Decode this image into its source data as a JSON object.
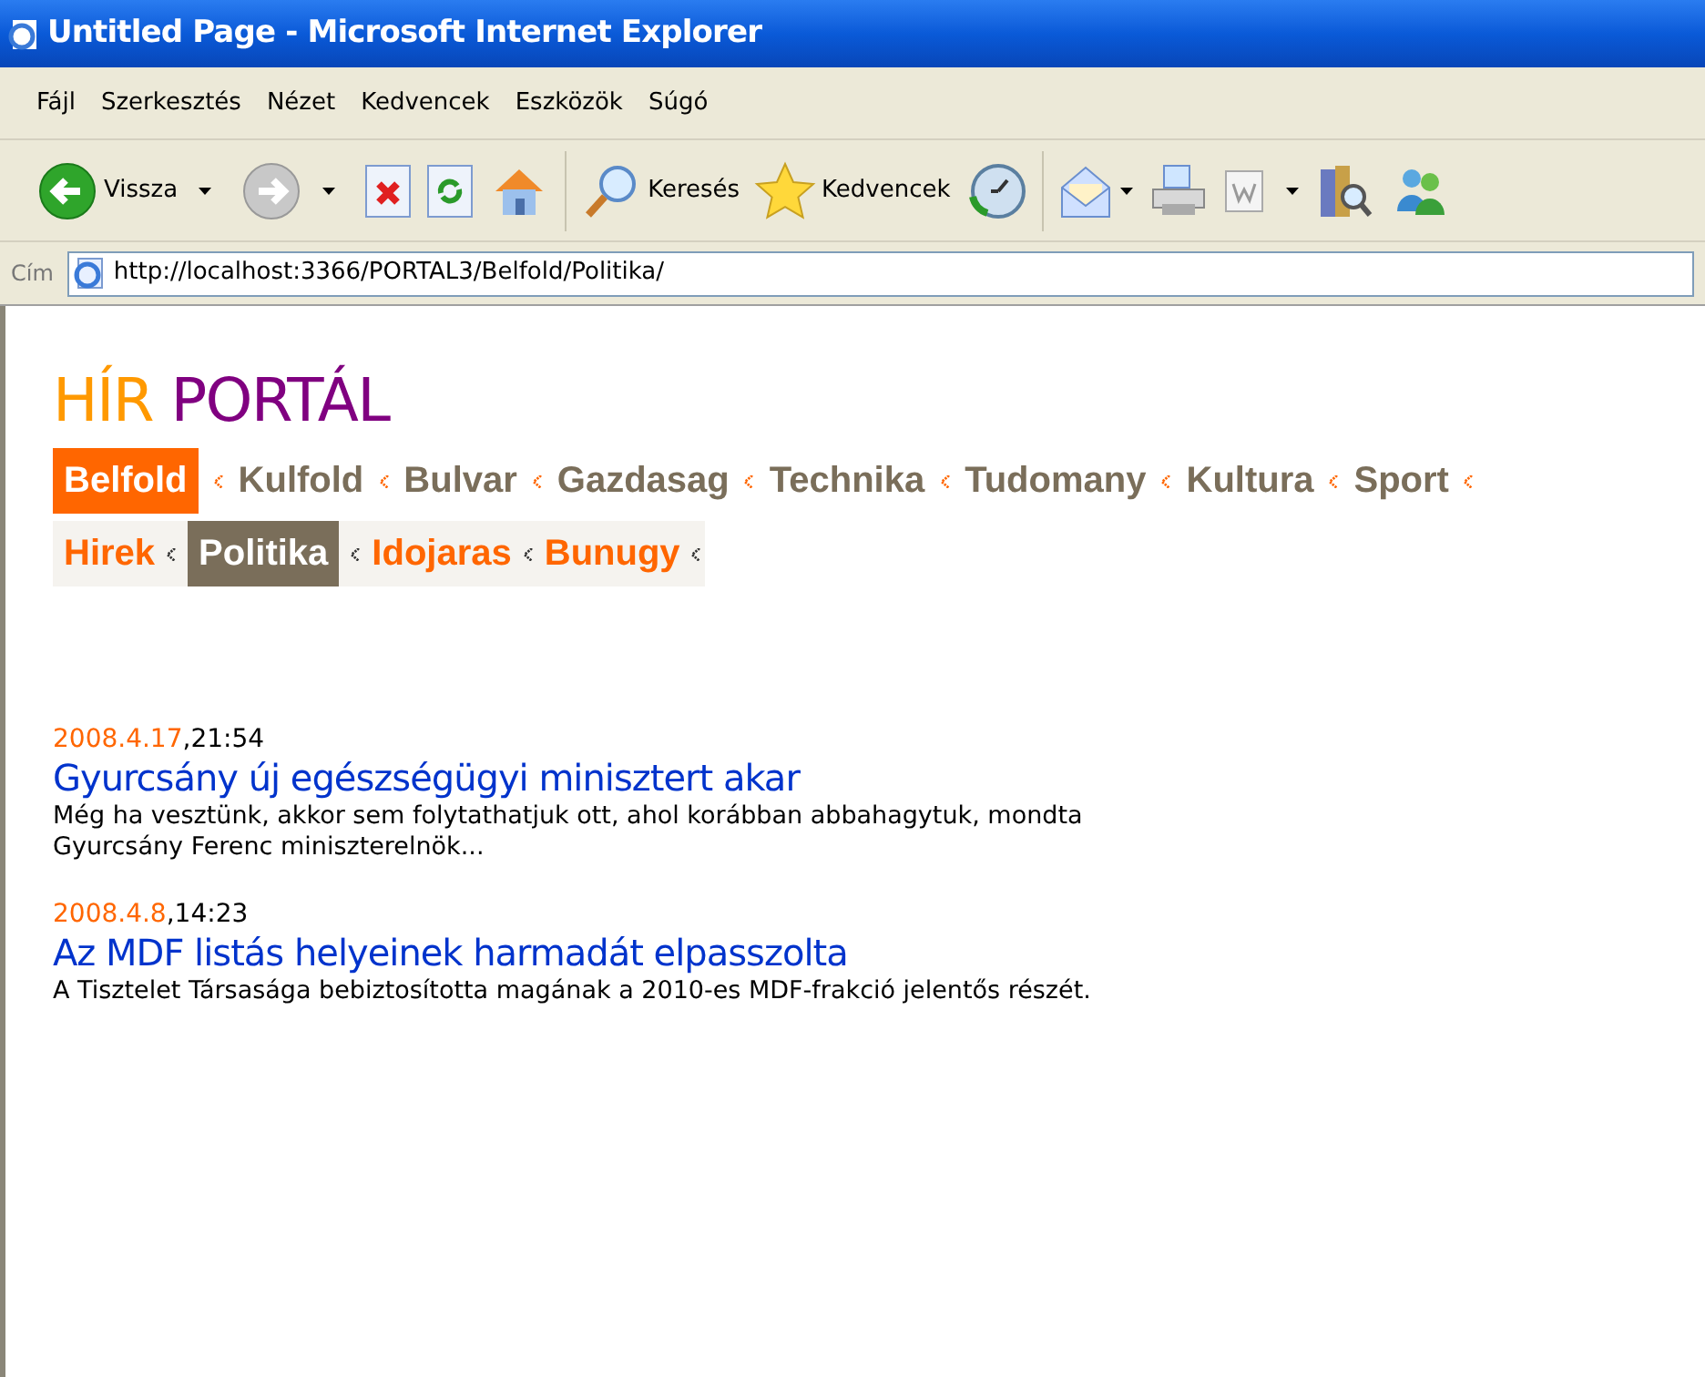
{
  "window": {
    "title": "Untitled Page - Microsoft Internet Explorer"
  },
  "menu": [
    "Fájl",
    "Szerkesztés",
    "Nézet",
    "Kedvencek",
    "Eszközök",
    "Súgó"
  ],
  "toolbar": [
    {
      "kind": "back",
      "label": "Vissza"
    },
    {
      "kind": "forward"
    },
    {
      "kind": "stop"
    },
    {
      "kind": "refresh"
    },
    {
      "kind": "home"
    },
    {
      "kind": "sep"
    },
    {
      "kind": "search",
      "label": "Keresés"
    },
    {
      "kind": "favorites",
      "label": "Kedvencek"
    },
    {
      "kind": "history"
    },
    {
      "kind": "sep"
    },
    {
      "kind": "mail"
    },
    {
      "kind": "print"
    },
    {
      "kind": "edit"
    },
    {
      "kind": "research"
    },
    {
      "kind": "messenger"
    }
  ],
  "address": {
    "label": "Cím",
    "value": "http://localhost:3366/PORTAL3/Belfold/Politika/"
  },
  "logo": {
    "first": "HÍR",
    "second": "PORTÁL"
  },
  "categories": [
    {
      "label": "Belfold",
      "selected": true
    },
    {
      "label": "Kulfold",
      "selected": false
    },
    {
      "label": "Bulvar",
      "selected": false
    },
    {
      "label": "Gazdasag",
      "selected": false
    },
    {
      "label": "Technika",
      "selected": false
    },
    {
      "label": "Tudomany",
      "selected": false
    },
    {
      "label": "Kultura",
      "selected": false
    },
    {
      "label": "Sport",
      "selected": false
    }
  ],
  "subcategories": [
    {
      "label": "Hirek",
      "selected": false
    },
    {
      "label": "Politika",
      "selected": true
    },
    {
      "label": "Idojaras",
      "selected": false
    },
    {
      "label": "Bunugy",
      "selected": false
    }
  ],
  "articles": [
    {
      "date": "2008.4.17",
      "time": ",21:54",
      "title": "Gyurcsány új egészségügyi minisztert akar",
      "summary": "Még ha vesztünk, akkor sem folytathatjuk ott, ahol korábban abbahagytuk, mondta Gyurcsány Ferenc miniszterelnök..."
    },
    {
      "date": "2008.4.8",
      "time": ",14:23",
      "title": "Az MDF listás helyeinek harmadát elpasszolta",
      "summary": "A Tisztelet Társasága bebiztosította magának a 2010-es MDF-frakció jelentős részét."
    }
  ]
}
